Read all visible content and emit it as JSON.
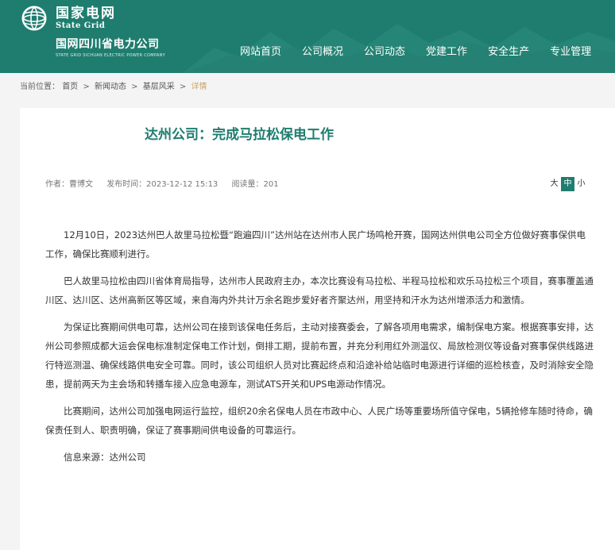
{
  "header": {
    "brand_cn": "国家电网",
    "brand_en": "State Grid",
    "company_cn": "国网四川省电力公司",
    "company_en": "STATE GRID SICHUAN ELECTRIC POWER COMPANY",
    "nav": [
      "网站首页",
      "公司概况",
      "公司动态",
      "党建工作",
      "安全生产",
      "专业管理"
    ],
    "color": "#1f7d6f"
  },
  "breadcrumb": {
    "prefix": "当前位置：",
    "items": [
      "首页",
      "新闻动态",
      "基层风采"
    ],
    "separator": ">",
    "current": "详情"
  },
  "article": {
    "title": "达州公司：完成马拉松保电工作",
    "author": "作者：曹博文",
    "time": "发布时间：2023-12-12 15:13",
    "views": "阅读量：201",
    "font_size": {
      "large": "大",
      "medium": "中",
      "small": "小",
      "active": "medium"
    },
    "paragraphs": [
      "12月10日，2023达州巴人故里马拉松暨“跑遍四川”达州站在达州市人民广场鸣枪开赛，国网达州供电公司全方位做好赛事保供电工作，确保比赛顺利进行。",
      "巴人故里马拉松由四川省体育局指导，达州市人民政府主办，本次比赛设有马拉松、半程马拉松和欢乐马拉松三个项目，赛事覆盖通川区、达川区、达州高新区等区域，来自海内外共计万余名跑步爱好者齐聚达州，用坚持和汗水为达州增添活力和激情。",
      "为保证比赛期间供电可靠，达州公司在接到该保电任务后，主动对接赛委会，了解各项用电需求，编制保电方案。根据赛事安排，达州公司参照成都大运会保电标准制定保电工作计划，倒排工期，提前布置，并充分利用红外测温仪、局放检测仪等设备对赛事保供线路进行特巡测温、确保线路供电安全可靠。同时，该公司组织人员对比赛起终点和沿途补给站临时电源进行详细的巡检核查，及时消除安全隐患，提前两天为主会场和转播车接入应急电源车，测试ATS开关和UPS电源动作情况。",
      "比赛期间，达州公司加强电网运行监控，组织20余名保电人员在市政中心、人民广场等重要场所值守保电，5辆抢修车随时待命，确保责任到人、职责明确，保证了赛事期间供电设备的可靠运行。",
      "信息来源：达州公司"
    ]
  }
}
